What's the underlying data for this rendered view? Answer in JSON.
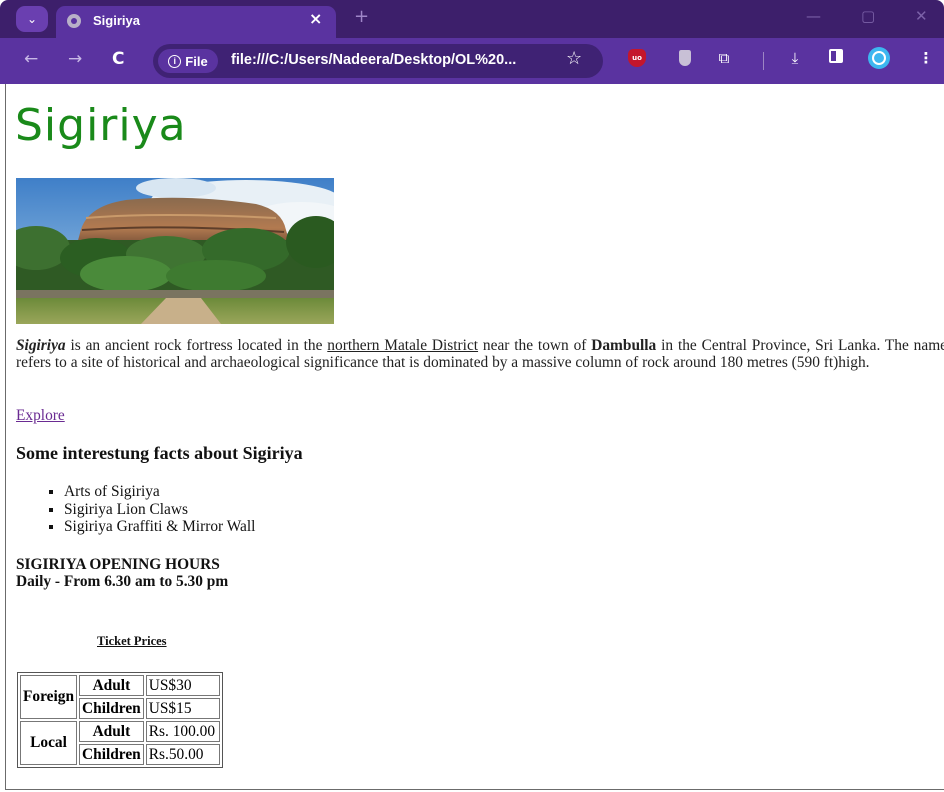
{
  "browser": {
    "tab_title": "Sigiriya",
    "tab_close": "×",
    "new_tab": "+",
    "menu_glyph": "⌄",
    "site_chip": "File",
    "url": "file:///C:/Users/Nadeera/Desktop/OL%20...",
    "win_min": "—",
    "win_max": "▢",
    "win_close": "✕"
  },
  "page": {
    "heading": "Sigiriya",
    "intro": {
      "name": "Sigiriya",
      "text1": " is an ancient rock fortress located in the ",
      "link": "northern Matale District",
      "text2": " near the town of ",
      "town": "Dambulla",
      "text3": " in the Central Province, Sri Lanka. The name refers to a site of historical and archaeological significance that is dominated by a massive column of rock around 180 metres (590 ft)high."
    },
    "explore_link": "Explore",
    "facts_heading": "Some interestung facts about Sigiriya",
    "facts": [
      "Arts of Sigiriya",
      "Sigiriya Lion Claws",
      "Sigiriya Graffiti & Mirror Wall"
    ],
    "hours_title": "SIGIRIYA OPENING HOURS",
    "hours_detail": "Daily - From 6.30 am to 5.30 pm",
    "ticket_caption": "Ticket Prices",
    "ticket_table": {
      "foreign": "Foreign",
      "local": "Local",
      "rows": [
        {
          "type": "Adult",
          "price": "US$30"
        },
        {
          "type": "Children",
          "price": "US$15"
        },
        {
          "type": "Adult",
          "price": "Rs. 100.00"
        },
        {
          "type": "Children",
          "price": "Rs.50.00"
        }
      ]
    }
  },
  "colors": {
    "tabbar": "#3d1f6b",
    "toolbar": "#5a33a0",
    "heading_green": "#1a8a1a",
    "visited_link": "#6a2b92"
  }
}
